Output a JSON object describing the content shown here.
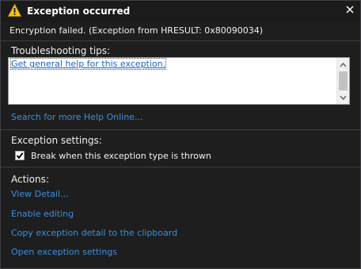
{
  "dialog": {
    "title": "Exception occurred",
    "title_icon": "warning-icon",
    "close_icon": "close-icon",
    "message": "Encryption failed. (Exception from HRESULT: 0x80090034)"
  },
  "troubleshooting": {
    "heading": "Troubleshooting tips:",
    "tips": [
      "Get general help for this exception."
    ],
    "search_link": "Search for more Help Online..."
  },
  "exception_settings": {
    "heading": "Exception settings:",
    "break_checkbox_label": "Break when this exception type is thrown",
    "break_checked": true
  },
  "actions": {
    "heading": "Actions:",
    "links": [
      "View Detail...",
      "Enable editing",
      "Copy exception detail to the clipboard",
      "Open exception settings"
    ]
  },
  "colors": {
    "background": "#1e1e1e",
    "link": "#3b8ee0",
    "warning": "#f5c518"
  }
}
